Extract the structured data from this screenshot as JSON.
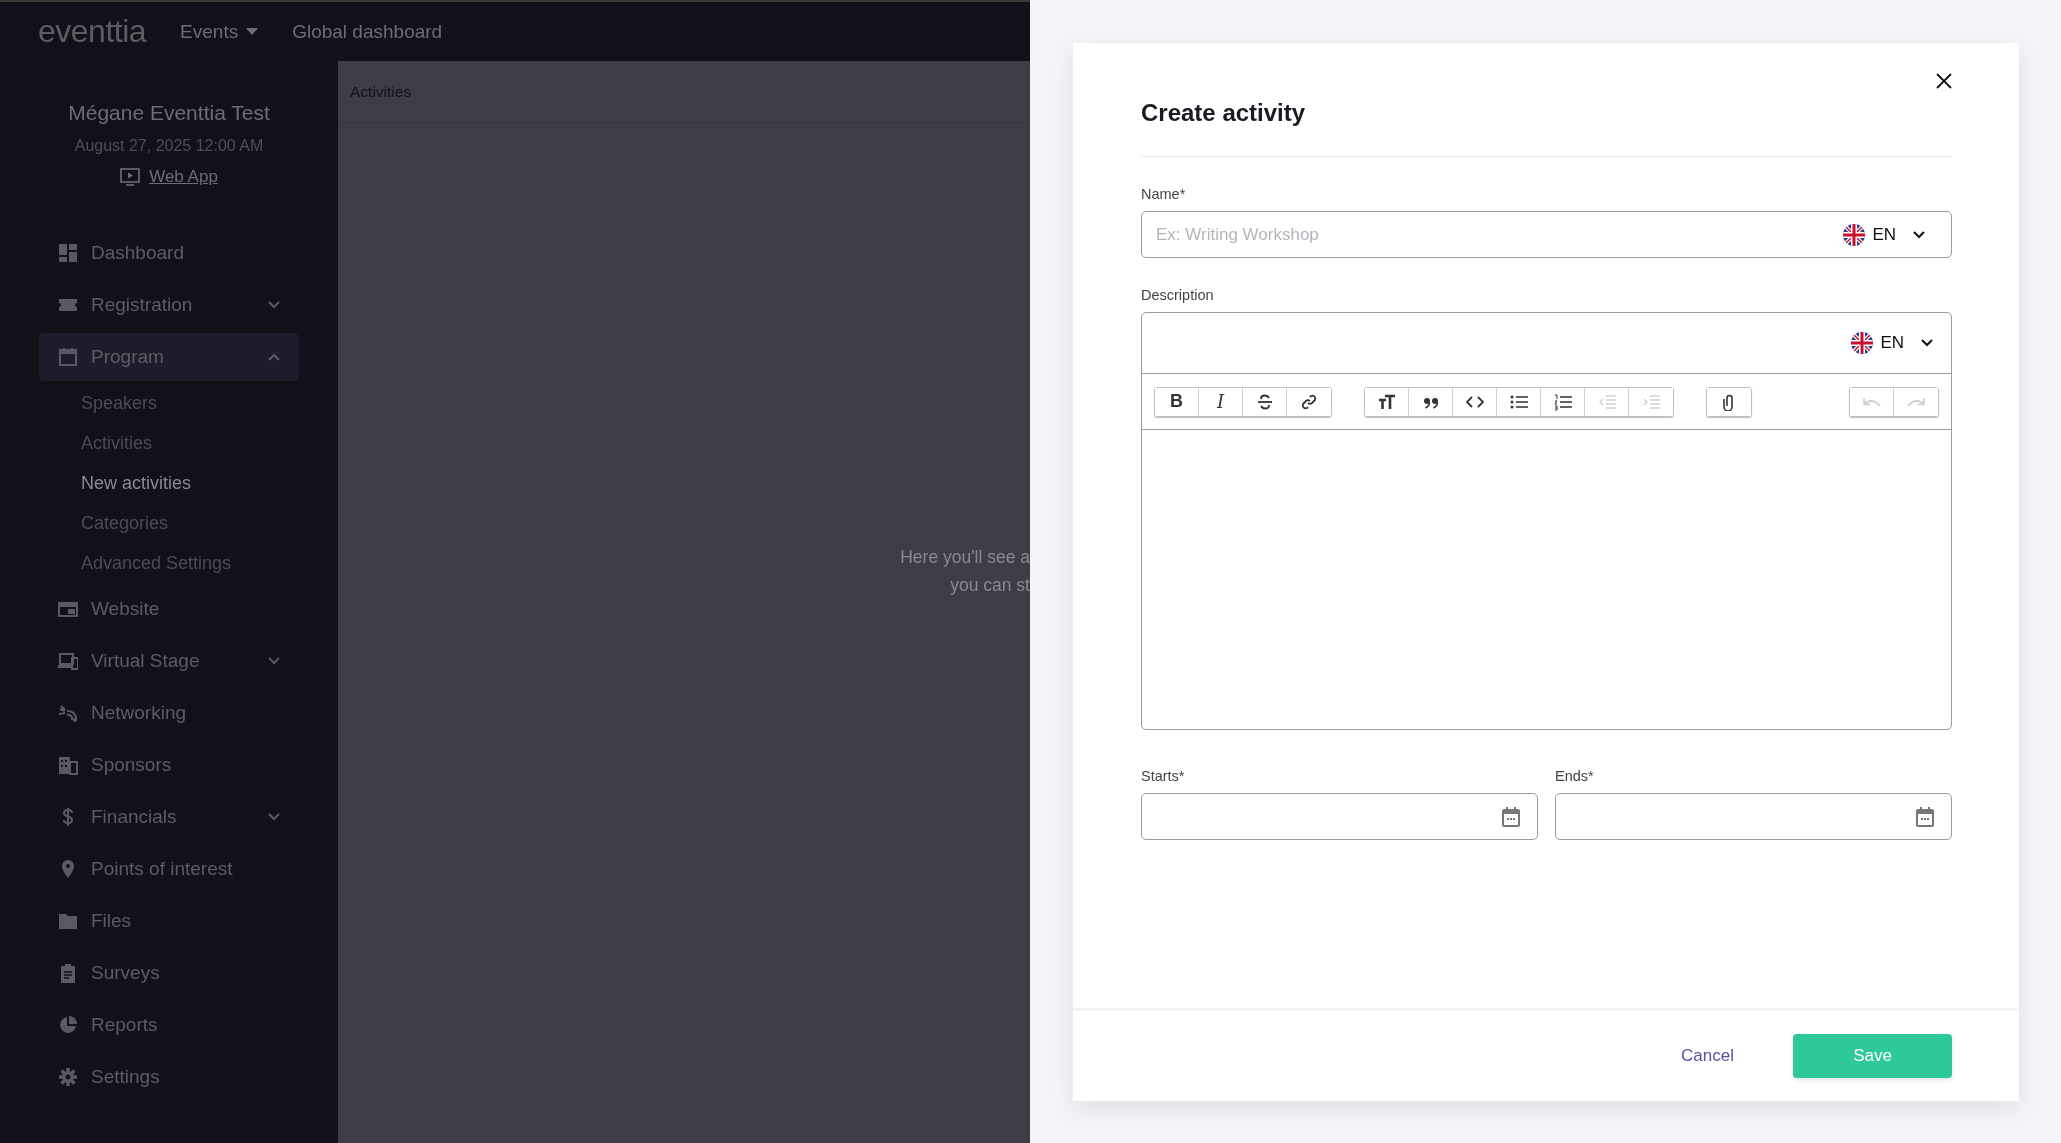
{
  "topbar": {
    "logo": "eventtia",
    "nav": [
      {
        "label": "Events",
        "dropdown": true
      },
      {
        "label": "Global dashboard",
        "dropdown": false
      }
    ]
  },
  "sidebar": {
    "event_name": "Mégane Eventtia Test",
    "event_date": "August 27, 2025 12:00 AM",
    "web_app_link": "Web App",
    "items": [
      {
        "label": "Dashboard",
        "kind": "dashboard",
        "selected": false
      },
      {
        "label": "Registration",
        "kind": "ticket",
        "expanded": false,
        "selected": false
      },
      {
        "label": "Program",
        "kind": "calendar",
        "expanded": true,
        "selected": true,
        "children": [
          {
            "label": "Speakers",
            "selected": false
          },
          {
            "label": "Activities",
            "selected": false
          },
          {
            "label": "New activities",
            "selected": true
          },
          {
            "label": "Categories",
            "selected": false
          },
          {
            "label": "Advanced Settings",
            "selected": false
          }
        ]
      },
      {
        "label": "Website",
        "kind": "website",
        "selected": false
      },
      {
        "label": "Virtual Stage",
        "kind": "devices",
        "expanded": false,
        "selected": false
      },
      {
        "label": "Networking",
        "kind": "networking",
        "selected": false
      },
      {
        "label": "Sponsors",
        "kind": "building",
        "selected": false
      },
      {
        "label": "Financials",
        "kind": "dollar",
        "expanded": false,
        "selected": false
      },
      {
        "label": "Points of interest",
        "kind": "pin",
        "selected": false
      },
      {
        "label": "Files",
        "kind": "folder",
        "selected": false
      },
      {
        "label": "Surveys",
        "kind": "clipboard",
        "selected": false
      },
      {
        "label": "Reports",
        "kind": "pie",
        "selected": false
      },
      {
        "label": "Settings",
        "kind": "gear",
        "selected": false
      }
    ]
  },
  "content": {
    "breadcrumb": "Activities",
    "empty_state": [
      "Here you'll see a",
      "you can st"
    ]
  },
  "modal": {
    "title": "Create activity",
    "name_field": {
      "label": "Name*",
      "placeholder": "Ex: Writing Workshop",
      "language": "EN"
    },
    "description_field": {
      "label": "Description",
      "language": "EN",
      "toolbar": [
        [
          {
            "kind": "bold",
            "glyph": "B",
            "disabled": false
          },
          {
            "kind": "italic",
            "glyph": "I",
            "disabled": false
          },
          {
            "kind": "strike",
            "disabled": false
          },
          {
            "kind": "link",
            "disabled": false
          }
        ],
        [
          {
            "kind": "heading",
            "disabled": false
          },
          {
            "kind": "quote",
            "disabled": false
          },
          {
            "kind": "code",
            "disabled": false
          },
          {
            "kind": "bullets",
            "disabled": false
          },
          {
            "kind": "numbers",
            "disabled": false
          },
          {
            "kind": "outdent",
            "disabled": true
          },
          {
            "kind": "indent",
            "disabled": true
          }
        ],
        [
          {
            "kind": "attach",
            "disabled": false
          }
        ],
        [
          {
            "kind": "undo",
            "disabled": true
          },
          {
            "kind": "redo",
            "disabled": true
          }
        ]
      ]
    },
    "date_fields": [
      {
        "label": "Starts*"
      },
      {
        "label": "Ends*"
      }
    ],
    "cancel": "Cancel",
    "save": "Save"
  }
}
